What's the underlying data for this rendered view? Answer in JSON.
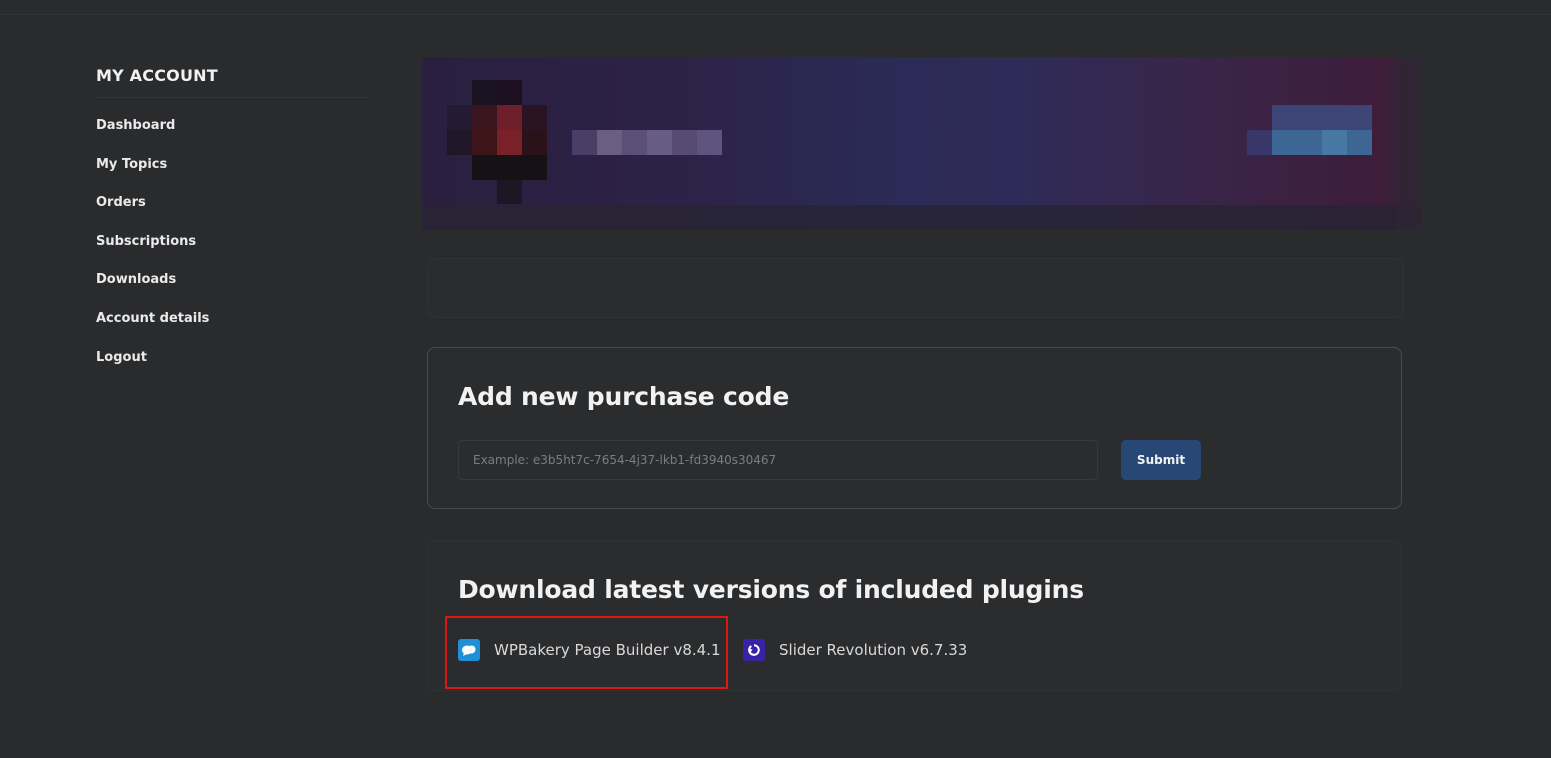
{
  "sidebar": {
    "title": "MY ACCOUNT",
    "items": [
      {
        "label": "Dashboard"
      },
      {
        "label": "My Topics"
      },
      {
        "label": "Orders"
      },
      {
        "label": "Subscriptions"
      },
      {
        "label": "Downloads"
      },
      {
        "label": "Account details"
      },
      {
        "label": "Logout"
      }
    ]
  },
  "purchase": {
    "heading": "Add new purchase code",
    "placeholder": "Example: e3b5ht7c-7654-4j37-lkb1-fd3940s30467",
    "submit_label": "Submit"
  },
  "plugins": {
    "heading": "Download latest versions of included plugins",
    "items": [
      {
        "label": "WPBakery Page Builder v8.4.1",
        "icon": "wpbakery-icon",
        "icon_color": "#1f8fd6"
      },
      {
        "label": "Slider Revolution v6.7.33",
        "icon": "slider-revolution-icon",
        "icon_color": "#3a22a8"
      }
    ]
  },
  "colors": {
    "background": "#2a2b2d",
    "submit_button": "#274774",
    "highlight_border": "#e01515"
  }
}
